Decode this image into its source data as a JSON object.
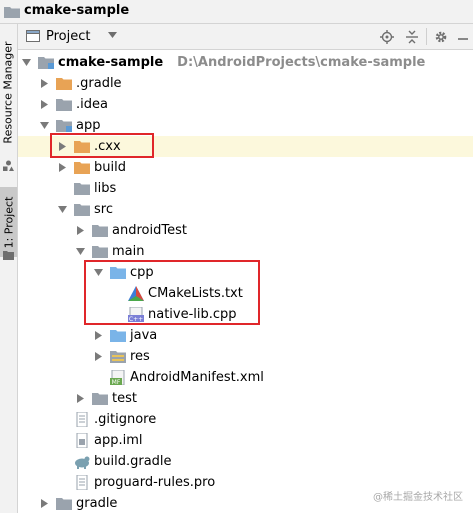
{
  "window_title": "cmake-sample",
  "side_tabs": {
    "resource_manager": "Resource Manager",
    "project": "1: Project"
  },
  "toolbar": {
    "view_label": "Project",
    "icons": [
      "locate-icon",
      "collapse-all-icon",
      "settings-icon",
      "minimize-icon"
    ]
  },
  "tree": [
    {
      "label": "cmake-sample",
      "path": "D:\\AndroidProjects\\cmake-sample",
      "icon": "module-folder",
      "expanded": true
    },
    {
      "label": ".gradle",
      "icon": "orange-folder",
      "expanded": false
    },
    {
      "label": ".idea",
      "icon": "gray-folder",
      "expanded": false
    },
    {
      "label": "app",
      "icon": "module-folder",
      "expanded": true
    },
    {
      "label": ".cxx",
      "icon": "orange-folder",
      "expanded": false
    },
    {
      "label": "build",
      "icon": "orange-folder",
      "expanded": false
    },
    {
      "label": "libs",
      "icon": "gray-folder"
    },
    {
      "label": "src",
      "icon": "gray-folder",
      "expanded": true
    },
    {
      "label": "androidTest",
      "icon": "gray-folder",
      "expanded": false
    },
    {
      "label": "main",
      "icon": "gray-folder",
      "expanded": true
    },
    {
      "label": "cpp",
      "icon": "blue-folder",
      "expanded": true
    },
    {
      "label": "CMakeLists.txt",
      "icon": "cmake-file"
    },
    {
      "label": "native-lib.cpp",
      "icon": "cpp-file"
    },
    {
      "label": "java",
      "icon": "blue-folder",
      "expanded": false
    },
    {
      "label": "res",
      "icon": "res-folder",
      "expanded": false
    },
    {
      "label": "AndroidManifest.xml",
      "icon": "manifest-file"
    },
    {
      "label": "test",
      "icon": "gray-folder",
      "expanded": false
    },
    {
      "label": ".gitignore",
      "icon": "text-file"
    },
    {
      "label": "app.iml",
      "icon": "iml-file"
    },
    {
      "label": "build.gradle",
      "icon": "gradle-file"
    },
    {
      "label": "proguard-rules.pro",
      "icon": "text-file"
    },
    {
      "label": "gradle",
      "icon": "gray-folder",
      "expanded": false
    }
  ],
  "watermark": "@稀土掘金技术社区"
}
